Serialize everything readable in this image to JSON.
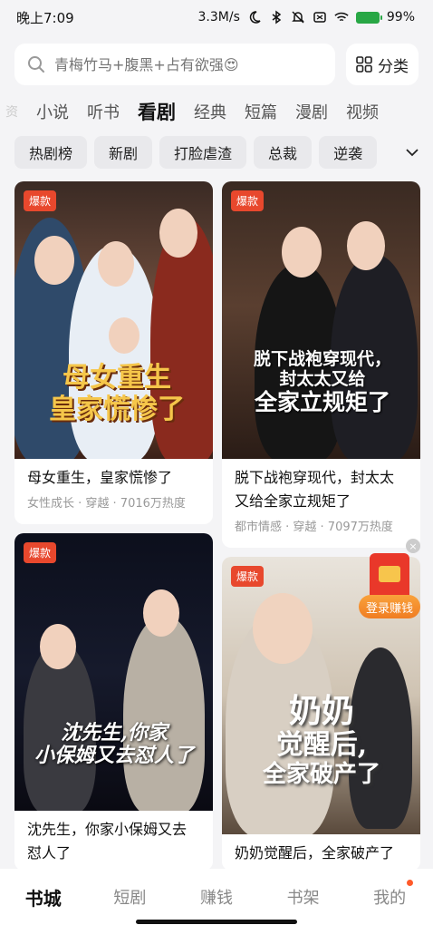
{
  "status_bar": {
    "time": "晚上7:09",
    "network_speed": "3.3M/s",
    "battery_percent": "99%"
  },
  "search": {
    "placeholder": "青梅竹马+腹黑+占有欲强😍",
    "category_label": "分类"
  },
  "main_tabs": [
    {
      "label": "资"
    },
    {
      "label": "小说"
    },
    {
      "label": "听书"
    },
    {
      "label": "看剧"
    },
    {
      "label": "经典"
    },
    {
      "label": "短篇"
    },
    {
      "label": "漫剧"
    },
    {
      "label": "视频"
    }
  ],
  "sub_tags": [
    "热剧榜",
    "新剧",
    "打脸虐渣",
    "总裁",
    "逆袭"
  ],
  "cards": [
    {
      "badge": "爆款",
      "poster_text_line1": "母女重生",
      "poster_text_line2": "皇家慌惨了",
      "title": "母女重生，皇家慌惨了",
      "meta": "女性成长 · 穿越 · 7016万热度"
    },
    {
      "badge": "爆款",
      "poster_text_line1": "脱下战袍穿现代，",
      "poster_text_line2": "封太太又给",
      "poster_text_line3": "全家立规矩了",
      "title": "脱下战袍穿现代，封太太又给全家立规矩了",
      "meta": "都市情感 · 穿越 · 7097万热度"
    },
    {
      "badge": "爆款",
      "poster_text_line1": "沈先生,你家",
      "poster_text_line2": "小保姆又去怼人了",
      "title": "沈先生，你家小保姆又去怼人了",
      "meta": ""
    },
    {
      "badge": "爆款",
      "poster_text_line1": "奶奶",
      "poster_text_line2": "觉醒后,",
      "poster_text_line3": "全家破产了",
      "title": "奶奶觉醒后，全家破产了",
      "meta": ""
    }
  ],
  "earn_float": {
    "label": "登录赚钱"
  },
  "bottom_nav": [
    {
      "label": "书城"
    },
    {
      "label": "短剧"
    },
    {
      "label": "赚钱"
    },
    {
      "label": "书架"
    },
    {
      "label": "我的"
    }
  ],
  "colors": {
    "accent": "#e8482d",
    "earn_orange": "#f07d22",
    "background": "#f4f4f6"
  }
}
